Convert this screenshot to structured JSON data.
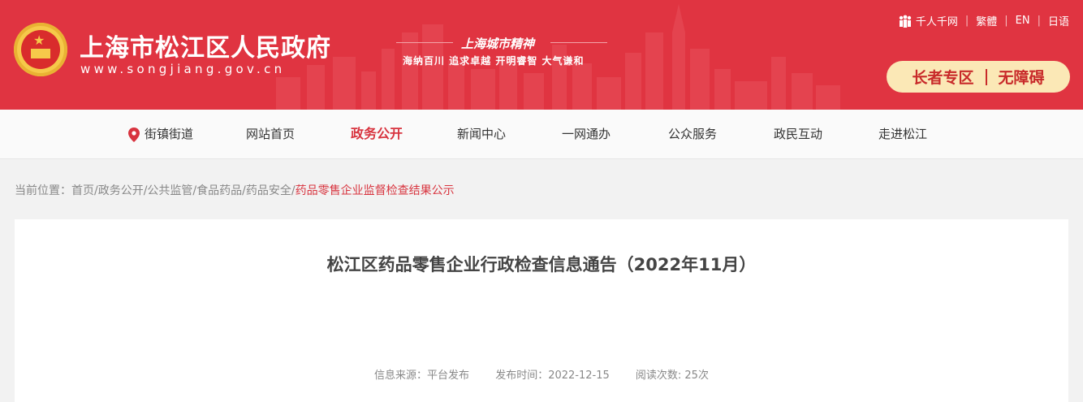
{
  "header": {
    "site_title": "上海市松江区人民政府",
    "site_url": "www.songjiang.gov.cn",
    "slogan_title": "上海城市精神",
    "slogan_text": "海纳百川  追求卓越  开明睿智  大气谦和",
    "top_links": [
      "千人千网",
      "繁體",
      "EN",
      "日语"
    ],
    "elder_zone": "长者专区",
    "accessibility": "无障碍"
  },
  "nav": {
    "items": [
      "街镇街道",
      "网站首页",
      "政务公开",
      "新闻中心",
      "一网通办",
      "公众服务",
      "政民互动",
      "走进松江"
    ],
    "active": "政务公开"
  },
  "breadcrumb": {
    "prefix": "当前位置：",
    "path": "首页/政务公开/公共监管/食品药品/药品安全/",
    "current": "药品零售企业监督检查结果公示"
  },
  "article": {
    "title": "松江区药品零售企业行政检查信息通告（2022年11月）",
    "source": "信息来源：平台发布",
    "publish_time": "发布时间：2022-12-15",
    "views": "阅读次数: 25次"
  },
  "colors": {
    "brand_red": "#e03441",
    "active_red": "#d8343f",
    "elder_bg": "#fbe8b6"
  }
}
